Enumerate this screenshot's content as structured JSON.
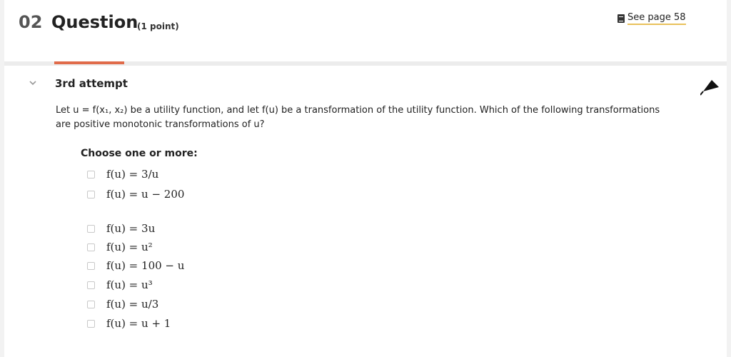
{
  "header": {
    "number": "02",
    "title": "Question",
    "points": "(1 point)",
    "see_page": "See page 58"
  },
  "attempt": {
    "label": "3rd attempt"
  },
  "question": {
    "prompt_line1": "Let u = f(x₁, x₂) be a utility function, and let f(u) be a transformation of the utility function. Which of the following transformations",
    "prompt_line2": "are positive monotonic transformations of u?",
    "choose_label": "Choose one or more:",
    "options": [
      "f(u) = 3/u",
      "f(u) = u − 200",
      "f(u) = 3u",
      "f(u) = u²",
      "f(u) = 100 − u",
      "f(u) = u³",
      "f(u) = u/3",
      "f(u) = u + 1"
    ]
  },
  "colors": {
    "accent": "#e06b4a",
    "link_underline": "#e9c25c"
  },
  "icons": {
    "page": "document-icon",
    "collapse": "chevron-down-icon",
    "flag": "flag-icon"
  }
}
